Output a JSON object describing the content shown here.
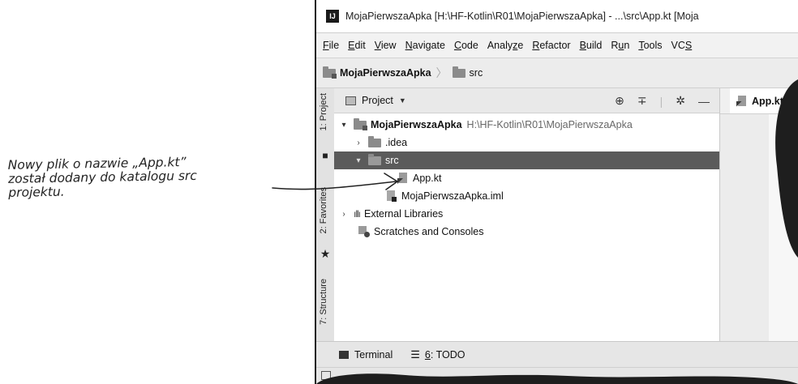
{
  "annotation": {
    "lines": [
      "Nowy plik o nazwie „App.kt”",
      "został dodany do katalogu src",
      "projektu."
    ]
  },
  "window": {
    "title": "MojaPierwszaApka [H:\\HF-Kotlin\\R01\\MojaPierwszaApka] - ...\\src\\App.kt [Moja",
    "app_icon": "IJ"
  },
  "menubar": {
    "items": [
      {
        "pre": "",
        "mn": "F",
        "post": "ile"
      },
      {
        "pre": "",
        "mn": "E",
        "post": "dit"
      },
      {
        "pre": "",
        "mn": "V",
        "post": "iew"
      },
      {
        "pre": "",
        "mn": "N",
        "post": "avigate"
      },
      {
        "pre": "",
        "mn": "C",
        "post": "ode"
      },
      {
        "pre": "Analy",
        "mn": "z",
        "post": "e"
      },
      {
        "pre": "",
        "mn": "R",
        "post": "efactor"
      },
      {
        "pre": "",
        "mn": "B",
        "post": "uild"
      },
      {
        "pre": "R",
        "mn": "u",
        "post": "n"
      },
      {
        "pre": "",
        "mn": "T",
        "post": "ools"
      },
      {
        "pre": "VC",
        "mn": "S",
        "post": ""
      }
    ]
  },
  "navbar": {
    "project": "MojaPierwszaApka",
    "folder": "src"
  },
  "side_tabs": {
    "project": "1: Project",
    "favorites": "2: Favorites",
    "structure": "7: Structure"
  },
  "project_panel": {
    "title": "Project",
    "tree": {
      "root_name": "MojaPierwszaApka",
      "root_path": "H:\\HF-Kotlin\\R01\\MojaPierwszaApka",
      "idea": ".idea",
      "src": "src",
      "app_file": "App.kt",
      "iml_file": "MojaPierwszaApka.iml",
      "external_libs": "External Libraries",
      "scratches": "Scratches and Consoles"
    }
  },
  "editor": {
    "tab_label": "App.kt",
    "tab_close": "×"
  },
  "bottom_tools": {
    "terminal": "Terminal",
    "todo_mn": "6",
    "todo_rest": ": TODO"
  },
  "icons": [
    "ij-logo-icon",
    "folder-icon",
    "kotlin-file-icon",
    "iml-file-icon",
    "library-icon",
    "scratch-icon",
    "target-icon",
    "collapse-icon",
    "gear-icon",
    "minimize-icon",
    "star-icon",
    "terminal-icon",
    "todo-icon",
    "close-icon",
    "chevron-down-icon",
    "chevron-right-icon"
  ]
}
